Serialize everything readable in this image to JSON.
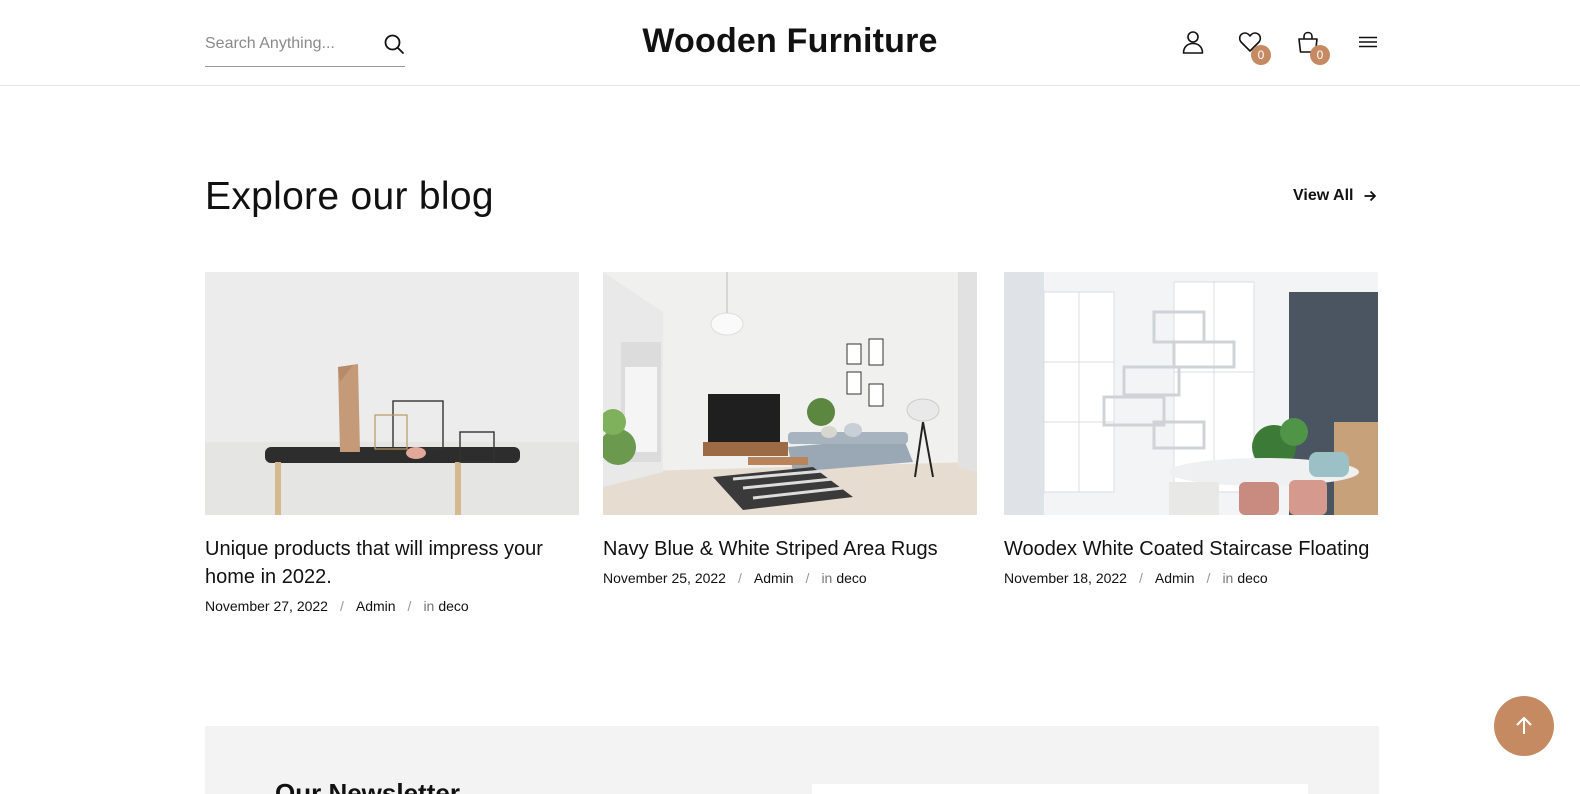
{
  "header": {
    "search_placeholder": "Search Anything...",
    "logo": "Wooden Furniture",
    "wishlist_count": "0",
    "cart_count": "0",
    "icons": [
      "search-icon",
      "user-icon",
      "heart-icon",
      "bag-icon",
      "menu-icon"
    ]
  },
  "blog": {
    "title": "Explore our blog",
    "view_all": "View All",
    "posts": [
      {
        "title": "Unique products that will impress your home in 2022.",
        "date": "November 27, 2022",
        "author": "Admin",
        "in_label": "in",
        "category": "deco"
      },
      {
        "title": "Navy Blue & White Striped Area Rugs",
        "date": "November 25, 2022",
        "author": "Admin",
        "in_label": "in",
        "category": "deco"
      },
      {
        "title": "Woodex White Coated Staircase Floating",
        "date": "November 18, 2022",
        "author": "Admin",
        "in_label": "in",
        "category": "deco"
      }
    ],
    "separator": "/"
  },
  "newsletter": {
    "title": "Our Newsletter"
  },
  "colors": {
    "accent": "#c68a63",
    "newsletter_bg": "#f3f3f3"
  }
}
